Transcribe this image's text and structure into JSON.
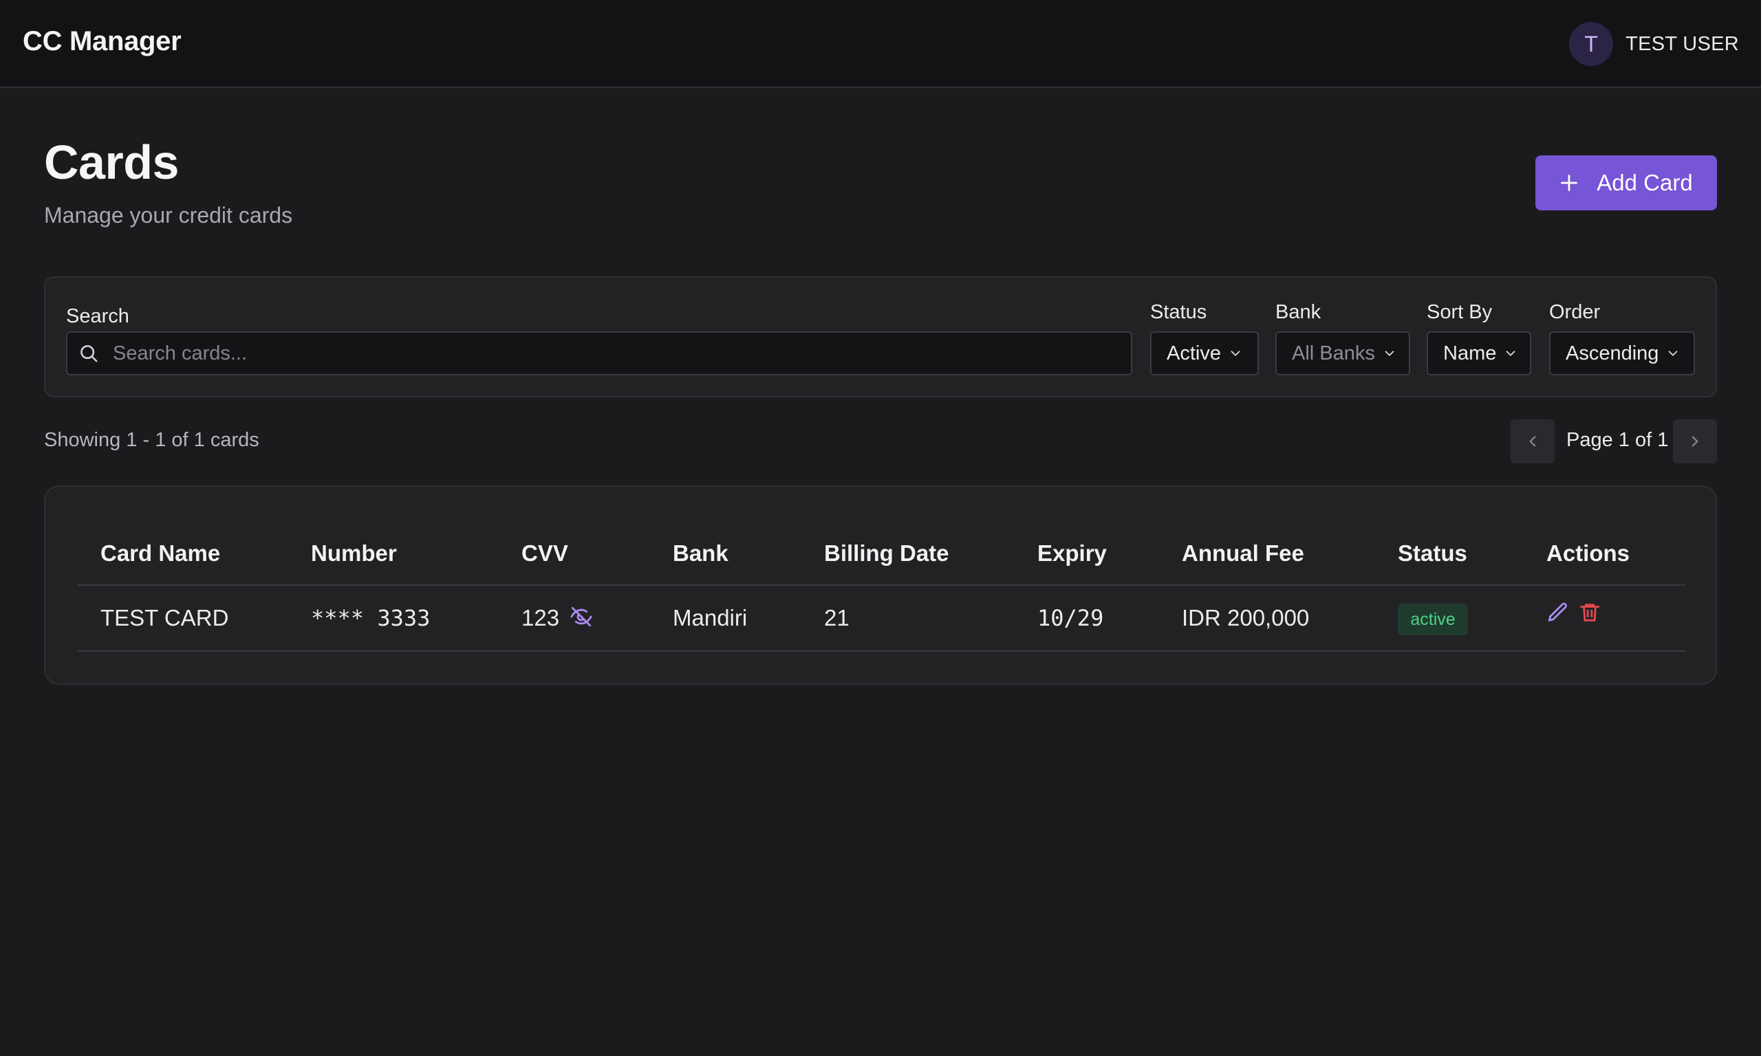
{
  "app": {
    "title": "CC Manager"
  },
  "user": {
    "initial": "T",
    "name": "TEST USER"
  },
  "page": {
    "title": "Cards",
    "subtitle": "Manage your credit cards",
    "add_button_label": "Add Card"
  },
  "filters": {
    "search": {
      "label": "Search",
      "placeholder": "Search cards...",
      "value": ""
    },
    "status": {
      "label": "Status",
      "value": "Active"
    },
    "bank": {
      "label": "Bank",
      "value": "All Banks"
    },
    "sort_by": {
      "label": "Sort By",
      "value": "Name"
    },
    "order": {
      "label": "Order",
      "value": "Ascending"
    }
  },
  "results": {
    "showing_text": "Showing 1 - 1 of 1 cards",
    "page_text": "Page 1 of 1"
  },
  "table": {
    "columns": [
      "Card Name",
      "Number",
      "CVV",
      "Bank",
      "Billing Date",
      "Expiry",
      "Annual Fee",
      "Status",
      "Actions"
    ],
    "rows": [
      {
        "card_name": "TEST CARD",
        "number": "**** 3333",
        "cvv": "123",
        "bank": "Mandiri",
        "billing_date": "21",
        "expiry": "10/29",
        "annual_fee": "IDR 200,000",
        "status": "active"
      }
    ]
  },
  "icons": {
    "add": "plus-icon",
    "search": "search-icon",
    "dropdown": "chevron-down-icon",
    "prev": "chevron-left-icon",
    "next": "chevron-right-icon",
    "cvv_toggle": "eye-off-icon",
    "edit": "pencil-icon",
    "delete": "trash-icon"
  },
  "colors": {
    "background": "#1b1b1d",
    "topbar": "#131315",
    "panel": "#222225",
    "accent": "#7655d6",
    "edit_icon": "#a98bf0",
    "delete_icon": "#e5484d",
    "status_active_bg": "#1f3b2d",
    "status_active_text": "#4fd18b"
  }
}
